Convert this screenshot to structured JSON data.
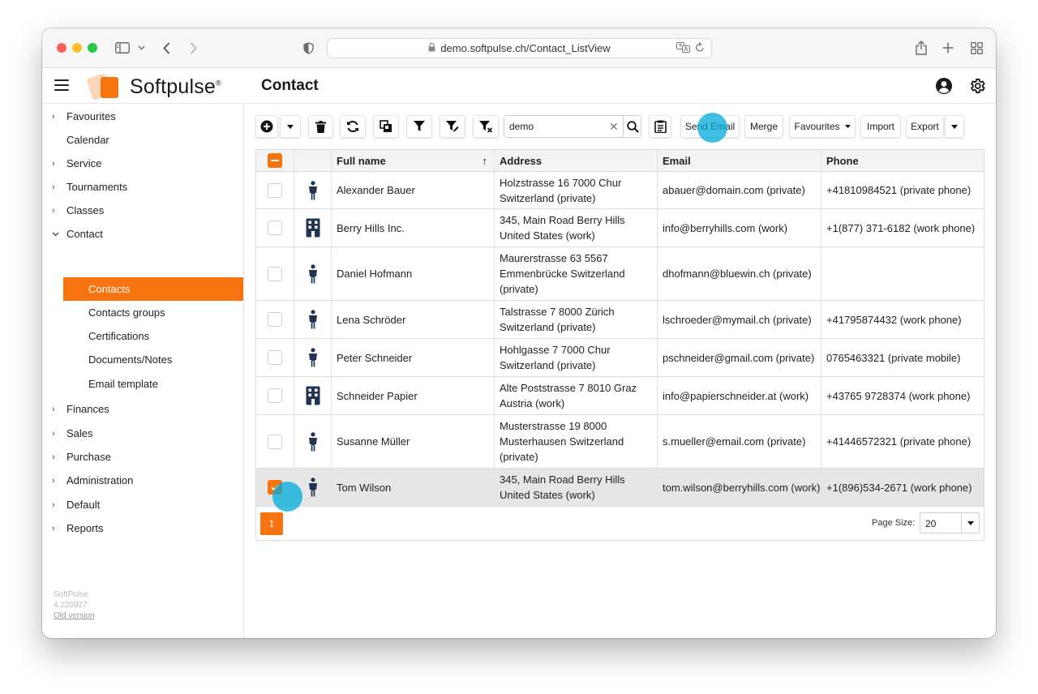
{
  "browser": {
    "url": "demo.softpulse.ch/Contact_ListView"
  },
  "app": {
    "logo_text": "Softpulse",
    "logo_mark": "®",
    "page_title": "Contact"
  },
  "sidebar": {
    "items": [
      {
        "label": "Favourites",
        "chevron": "›"
      },
      {
        "label": "Calendar",
        "chevron": ""
      },
      {
        "label": "Service",
        "chevron": "›"
      },
      {
        "label": "Tournaments",
        "chevron": "›"
      },
      {
        "label": "Classes",
        "chevron": "›"
      },
      {
        "label": "Contact",
        "chevron": "⌄"
      }
    ],
    "sub_items": [
      {
        "label": "Contacts"
      },
      {
        "label": "Contacts groups"
      },
      {
        "label": "Certifications"
      },
      {
        "label": "Documents/Notes"
      },
      {
        "label": "Email template"
      }
    ],
    "items_after": [
      {
        "label": "Finances",
        "chevron": "›"
      },
      {
        "label": "Sales",
        "chevron": "›"
      },
      {
        "label": "Purchase",
        "chevron": "›"
      },
      {
        "label": "Administration",
        "chevron": "›"
      },
      {
        "label": "Default",
        "chevron": "›"
      },
      {
        "label": "Reports",
        "chevron": "›"
      }
    ],
    "version_name": "SoftPulse",
    "version_number": "4.220927",
    "old_version_link": "Old version"
  },
  "toolbar": {
    "search_value": "demo",
    "clear_glyph": "✕",
    "send_email_label": "Send Email",
    "merge_label": "Merge",
    "favourites_label": "Favourites",
    "import_label": "Import",
    "export_label": "Export"
  },
  "grid": {
    "columns": {
      "full_name": "Full name",
      "address": "Address",
      "email": "Email",
      "phone": "Phone"
    },
    "sort_glyph": "↑",
    "rows": [
      {
        "type": "person",
        "name": "Alexander Bauer",
        "address": "Holzstrasse 16 7000 Chur Switzerland (private)",
        "email": "abauer@domain.com (private)",
        "phone": "+41810984521 (private phone)",
        "checked": false
      },
      {
        "type": "company",
        "name": "Berry Hills Inc.",
        "address": "345, Main Road Berry Hills United States (work)",
        "email": "info@berryhills.com (work)",
        "phone": "+1(877) 371-6182 (work phone)",
        "checked": false
      },
      {
        "type": "person",
        "name": "Daniel Hofmann",
        "address": "Maurerstrasse 63 5567 Emmenbrücke Switzerland (private)",
        "email": "dhofmann@bluewin.ch (private)",
        "phone": "",
        "checked": false
      },
      {
        "type": "person",
        "name": "Lena Schröder",
        "address": "Talstrasse 7 8000 Zürich Switzerland (private)",
        "email": "lschroeder@mymail.ch (private)",
        "phone": "+41795874432 (work phone)",
        "checked": false
      },
      {
        "type": "person",
        "name": "Peter Schneider",
        "address": "Hohlgasse 7 7000 Chur Switzerland (private)",
        "email": "pschneider@gmail.com (private)",
        "phone": "0765463321 (private mobile)",
        "checked": false
      },
      {
        "type": "company",
        "name": "Schneider Papier",
        "address": "Alte Poststrasse 7 8010 Graz Austria (work)",
        "email": "info@papierschneider.at (work)",
        "phone": "+43765 9728374 (work phone)",
        "checked": false
      },
      {
        "type": "person",
        "name": "Susanne Müller",
        "address": "Musterstrasse 19 8000 Musterhausen Switzerland (private)",
        "email": "s.mueller@email.com (private)",
        "phone": "+41446572321 (private phone)",
        "checked": false
      },
      {
        "type": "person",
        "name": "Tom Wilson",
        "address": "345, Main Road Berry Hills United States (work)",
        "email": "tom.wilson@berryhills.com (work)",
        "phone": "+1(896)534-2671 (work phone)",
        "checked": true
      }
    ]
  },
  "pager": {
    "current_page": "1",
    "page_size_label": "Page Size:",
    "page_size": "20"
  },
  "colors": {
    "accent": "#f7730e",
    "selected_row": "#e6e6e6",
    "click_indicator": "#00aadc"
  }
}
